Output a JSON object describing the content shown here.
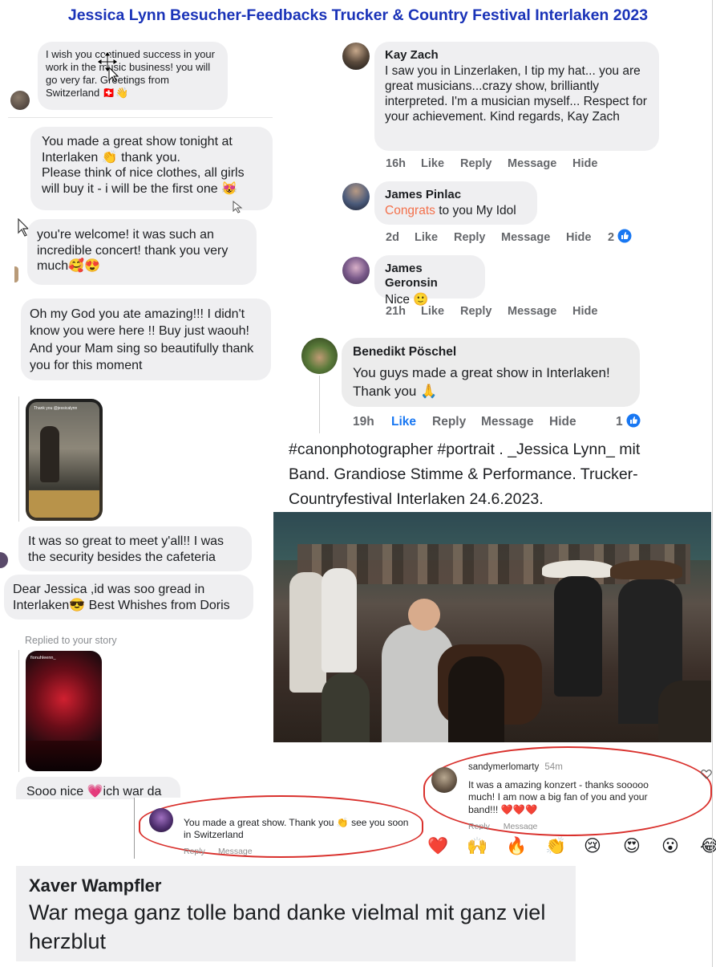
{
  "title": "Jessica Lynn Besucher-Feedbacks Trucker & Country Festival Interlaken 2023",
  "left_chat": {
    "m1": "I wish you continued success in your work in the music business! you will go very far. Greetings from Switzerland 🇨🇭👋",
    "m2_l1": "You made a great show tonight at",
    "m2_l2": "Interlaken 👏 thank you.",
    "m2_l3": "Please think of nice clothes, all girls",
    "m2_l4": "will buy it - i will be the first one 😻",
    "m3": "you're welcome! it was such an incredible concert! thank you very much🥰😍",
    "m4": "Oh my God you ate amazing!!! I didn't know you were here !! Buy just waouh! And your Mam sing so beautifully thank you for this moment",
    "story1_caption": "Thank you @jessicalynn",
    "m5": "It was so great to meet y'all!! I was the security besides the cafeteria",
    "m6": "Dear Jessica ,id was soo gread in Interlaken😎 Best Whishes from Doris",
    "replied": "Replied to your story",
    "story2_user": "fionuhleenn_",
    "m7": "Sooo nice 💗ich war da"
  },
  "fb_comments": [
    {
      "name": "Kay Zach",
      "text": "I saw you in Linzerlaken, I tip my hat... you are great musicians...crazy show, brilliantly interpreted.  I'm a musician myself... Respect for your achievement.  Kind regards, Kay Zach",
      "time": "16h",
      "like": "Like",
      "reply": "Reply",
      "message": "Message",
      "hide": "Hide"
    },
    {
      "name": "James Pinlac",
      "highlight": "Congrats",
      "text": " to you My Idol",
      "time": "2d",
      "like": "Like",
      "reply": "Reply",
      "message": "Message",
      "hide": "Hide",
      "count": "2"
    },
    {
      "name": "James Geronsin",
      "text": "Nice 🙂",
      "time": "21h",
      "like": "Like",
      "reply": "Reply",
      "message": "Message",
      "hide": "Hide"
    },
    {
      "name": "Benedikt Pöschel",
      "text": "You guys made a great show in Interlaken! Thank you 🙏",
      "time": "19h",
      "like": "Like",
      "reply": "Reply",
      "message": "Message",
      "hide": "Hide",
      "count": "1"
    }
  ],
  "caption": "#canonphotographer #portrait . _Jessica Lynn_ mit Band. Grandiose Stimme & Performance. Trucker-Countryfestival Interlaken 24.6.2023.",
  "ig_comment1": {
    "text": "You made a great show. Thank you 👏 see you soon in Switzerland",
    "reply": "Reply",
    "message": "Message"
  },
  "ig_comment2": {
    "user": "sandymerlomarty",
    "time": "54m",
    "text": "It was a amazing konzert - thanks sooooo much! I am now a big fan of you and your band!!! ❤️❤️❤️",
    "reply": "Reply",
    "message": "Message"
  },
  "reactions": [
    "❤️",
    "🙌",
    "🔥",
    "👏",
    "😢",
    "😍",
    "😮",
    "😂"
  ],
  "xaver": {
    "name": "Xaver Wampfler",
    "text": "War mega ganz tolle band danke vielmal mit ganz viel herzblut"
  },
  "colors": {
    "title": "#1a33b8",
    "like_blue": "#1877f2",
    "highlight": "#f3704b",
    "red_circle": "#d9302c"
  }
}
